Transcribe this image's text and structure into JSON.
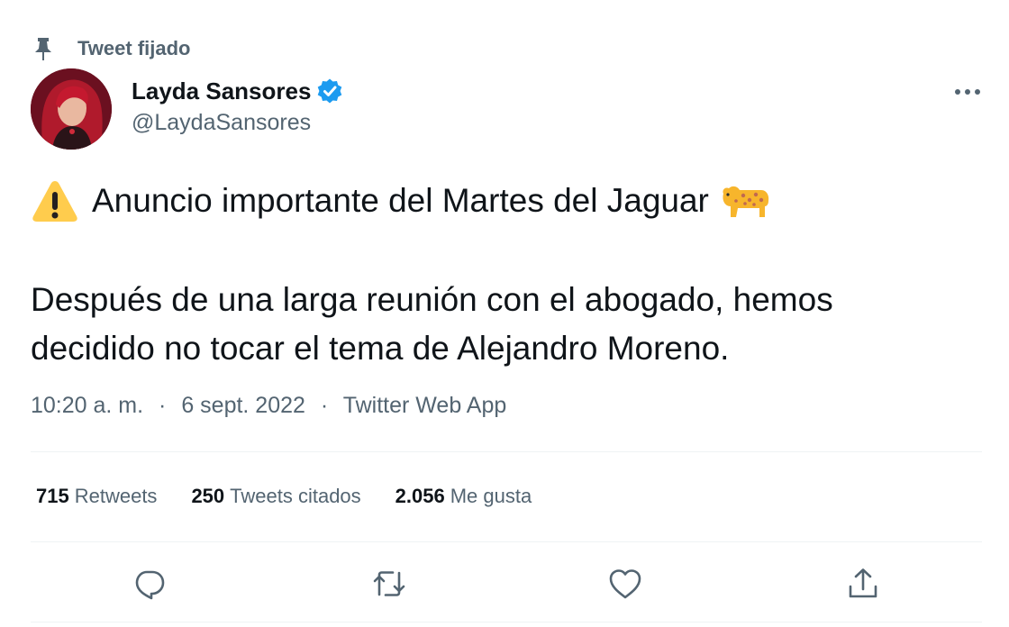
{
  "pinned": {
    "label": "Tweet fijado",
    "icon": "pin-icon"
  },
  "author": {
    "display_name": "Layda Sansores",
    "handle": "@LaydaSansores",
    "verified_color": "#1d9bf0"
  },
  "tweet": {
    "line1": "Anuncio importante del Martes del Jaguar",
    "line1_emoji_start": "warning-emoji",
    "line1_emoji_end": "leopard-emoji",
    "line2": "Después de una larga reunión con el abogado, hemos",
    "line3": "decidido no tocar el tema de Alejandro Moreno."
  },
  "meta": {
    "time": "10:20 a. m.",
    "date": "6 sept. 2022",
    "source": "Twitter Web App",
    "separator": "·"
  },
  "stats": {
    "retweets_count": "715",
    "retweets_label": "Retweets",
    "quotes_count": "250",
    "quotes_label": "Tweets citados",
    "likes_count": "2.056",
    "likes_label": "Me gusta"
  },
  "actions": [
    "reply-icon",
    "retweet-icon",
    "like-icon",
    "share-icon"
  ],
  "colors": {
    "text": "#0f1419",
    "secondary": "#536471",
    "divider": "#eff3f4",
    "verified": "#1d9bf0"
  }
}
